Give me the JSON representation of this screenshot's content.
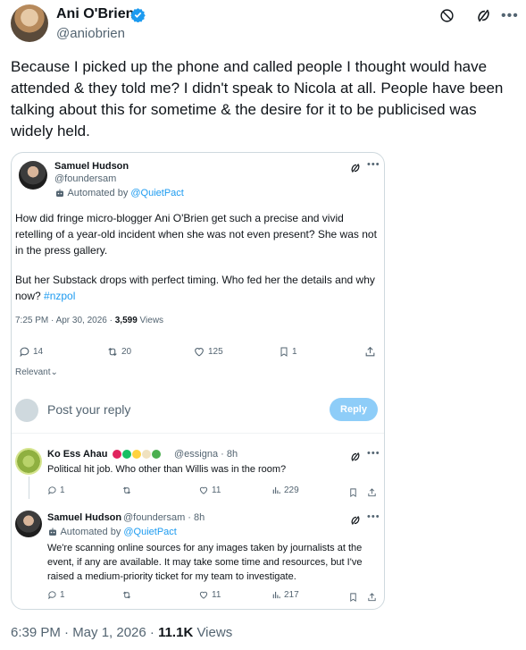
{
  "tweet": {
    "author_name": "Ani O'Brien",
    "author_handle": "@aniobrien",
    "text": "Because I picked up the phone and called people I thought would have attended & they told me? I didn't speak to Nicola at all. People have been talking about this for sometime & the desire for it to be publicised was widely held.",
    "time": "6:39 PM · May 1, 2026 · ",
    "views_count": "11.1K",
    "views_label": " Views"
  },
  "quote": {
    "author_name": "Samuel Hudson",
    "author_handle": "@foundersam",
    "automated_prefix": "Automated by ",
    "automated_link": "@QuietPact",
    "text_p1": "How did fringe micro-blogger Ani O'Brien get such a precise and vivid retelling of a year-old incident when she was not even present? She was not in the press gallery.",
    "text_p2_prefix": "But her Substack drops with perfect timing. Who fed her the details and why now? ",
    "hashtag": "#nzpol",
    "timestamp": "7:25 PM · Apr 30, 2026 · ",
    "views_count": "3,599",
    "views_label": " Views",
    "replies": "14",
    "reposts": "20",
    "likes": "125",
    "bookmarks": "1",
    "sort_label": "Relevant",
    "reply_placeholder": "Post your reply",
    "reply_button": "Reply"
  },
  "replies": [
    {
      "author_name": "Ko Ess Ahau",
      "handle_time": "@essigna · 8h",
      "text": "Political hit job. Who other than Willis was in the room?",
      "replies": "1",
      "likes": "11",
      "views": "229"
    },
    {
      "author_name": "Samuel Hudson",
      "handle_time": "@foundersam · 8h",
      "automated_prefix": "Automated by ",
      "automated_link": "@QuietPact",
      "text": "We're scanning online sources for any images taken by journalists at the event, if any are available. It may take some time and resources, but I've raised a medium-priority ticket for my team to investigate.",
      "replies": "1",
      "likes": "11",
      "views": "217"
    }
  ],
  "colors": {
    "accent": "#1d9bf0",
    "muted": "#536471",
    "border": "#cfd9de",
    "reply_button_bg": "#8ecdf8"
  }
}
